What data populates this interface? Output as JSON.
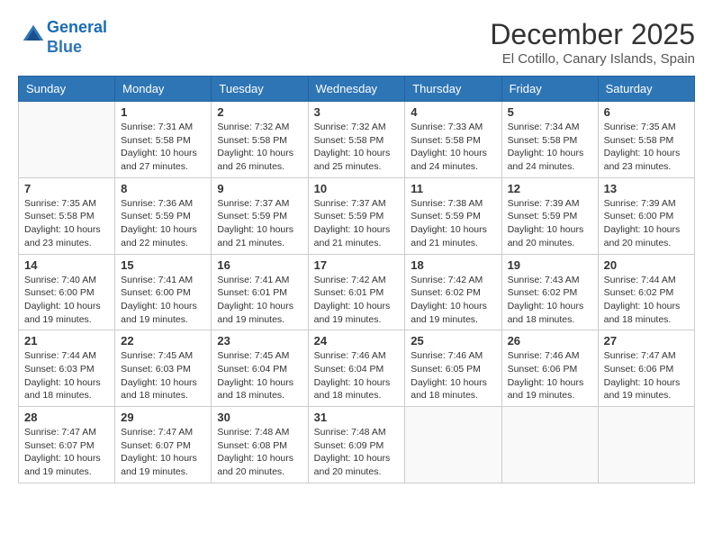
{
  "header": {
    "logo_line1": "General",
    "logo_line2": "Blue",
    "month": "December 2025",
    "location": "El Cotillo, Canary Islands, Spain"
  },
  "weekdays": [
    "Sunday",
    "Monday",
    "Tuesday",
    "Wednesday",
    "Thursday",
    "Friday",
    "Saturday"
  ],
  "weeks": [
    [
      {
        "day": "",
        "info": ""
      },
      {
        "day": "1",
        "info": "Sunrise: 7:31 AM\nSunset: 5:58 PM\nDaylight: 10 hours\nand 27 minutes."
      },
      {
        "day": "2",
        "info": "Sunrise: 7:32 AM\nSunset: 5:58 PM\nDaylight: 10 hours\nand 26 minutes."
      },
      {
        "day": "3",
        "info": "Sunrise: 7:32 AM\nSunset: 5:58 PM\nDaylight: 10 hours\nand 25 minutes."
      },
      {
        "day": "4",
        "info": "Sunrise: 7:33 AM\nSunset: 5:58 PM\nDaylight: 10 hours\nand 24 minutes."
      },
      {
        "day": "5",
        "info": "Sunrise: 7:34 AM\nSunset: 5:58 PM\nDaylight: 10 hours\nand 24 minutes."
      },
      {
        "day": "6",
        "info": "Sunrise: 7:35 AM\nSunset: 5:58 PM\nDaylight: 10 hours\nand 23 minutes."
      }
    ],
    [
      {
        "day": "7",
        "info": "Sunrise: 7:35 AM\nSunset: 5:58 PM\nDaylight: 10 hours\nand 23 minutes."
      },
      {
        "day": "8",
        "info": "Sunrise: 7:36 AM\nSunset: 5:59 PM\nDaylight: 10 hours\nand 22 minutes."
      },
      {
        "day": "9",
        "info": "Sunrise: 7:37 AM\nSunset: 5:59 PM\nDaylight: 10 hours\nand 21 minutes."
      },
      {
        "day": "10",
        "info": "Sunrise: 7:37 AM\nSunset: 5:59 PM\nDaylight: 10 hours\nand 21 minutes."
      },
      {
        "day": "11",
        "info": "Sunrise: 7:38 AM\nSunset: 5:59 PM\nDaylight: 10 hours\nand 21 minutes."
      },
      {
        "day": "12",
        "info": "Sunrise: 7:39 AM\nSunset: 5:59 PM\nDaylight: 10 hours\nand 20 minutes."
      },
      {
        "day": "13",
        "info": "Sunrise: 7:39 AM\nSunset: 6:00 PM\nDaylight: 10 hours\nand 20 minutes."
      }
    ],
    [
      {
        "day": "14",
        "info": "Sunrise: 7:40 AM\nSunset: 6:00 PM\nDaylight: 10 hours\nand 19 minutes."
      },
      {
        "day": "15",
        "info": "Sunrise: 7:41 AM\nSunset: 6:00 PM\nDaylight: 10 hours\nand 19 minutes."
      },
      {
        "day": "16",
        "info": "Sunrise: 7:41 AM\nSunset: 6:01 PM\nDaylight: 10 hours\nand 19 minutes."
      },
      {
        "day": "17",
        "info": "Sunrise: 7:42 AM\nSunset: 6:01 PM\nDaylight: 10 hours\nand 19 minutes."
      },
      {
        "day": "18",
        "info": "Sunrise: 7:42 AM\nSunset: 6:02 PM\nDaylight: 10 hours\nand 19 minutes."
      },
      {
        "day": "19",
        "info": "Sunrise: 7:43 AM\nSunset: 6:02 PM\nDaylight: 10 hours\nand 18 minutes."
      },
      {
        "day": "20",
        "info": "Sunrise: 7:44 AM\nSunset: 6:02 PM\nDaylight: 10 hours\nand 18 minutes."
      }
    ],
    [
      {
        "day": "21",
        "info": "Sunrise: 7:44 AM\nSunset: 6:03 PM\nDaylight: 10 hours\nand 18 minutes."
      },
      {
        "day": "22",
        "info": "Sunrise: 7:45 AM\nSunset: 6:03 PM\nDaylight: 10 hours\nand 18 minutes."
      },
      {
        "day": "23",
        "info": "Sunrise: 7:45 AM\nSunset: 6:04 PM\nDaylight: 10 hours\nand 18 minutes."
      },
      {
        "day": "24",
        "info": "Sunrise: 7:46 AM\nSunset: 6:04 PM\nDaylight: 10 hours\nand 18 minutes."
      },
      {
        "day": "25",
        "info": "Sunrise: 7:46 AM\nSunset: 6:05 PM\nDaylight: 10 hours\nand 18 minutes."
      },
      {
        "day": "26",
        "info": "Sunrise: 7:46 AM\nSunset: 6:06 PM\nDaylight: 10 hours\nand 19 minutes."
      },
      {
        "day": "27",
        "info": "Sunrise: 7:47 AM\nSunset: 6:06 PM\nDaylight: 10 hours\nand 19 minutes."
      }
    ],
    [
      {
        "day": "28",
        "info": "Sunrise: 7:47 AM\nSunset: 6:07 PM\nDaylight: 10 hours\nand 19 minutes."
      },
      {
        "day": "29",
        "info": "Sunrise: 7:47 AM\nSunset: 6:07 PM\nDaylight: 10 hours\nand 19 minutes."
      },
      {
        "day": "30",
        "info": "Sunrise: 7:48 AM\nSunset: 6:08 PM\nDaylight: 10 hours\nand 20 minutes."
      },
      {
        "day": "31",
        "info": "Sunrise: 7:48 AM\nSunset: 6:09 PM\nDaylight: 10 hours\nand 20 minutes."
      },
      {
        "day": "",
        "info": ""
      },
      {
        "day": "",
        "info": ""
      },
      {
        "day": "",
        "info": ""
      }
    ]
  ]
}
